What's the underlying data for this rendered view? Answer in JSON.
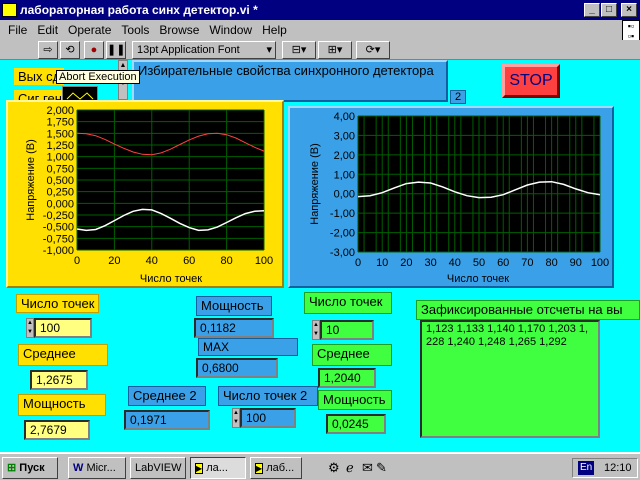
{
  "window": {
    "title": "лабораторная работа синх детектор.vi *"
  },
  "menu": [
    "File",
    "Edit",
    "Operate",
    "Tools",
    "Browse",
    "Window",
    "Help"
  ],
  "toolbar": {
    "font": "13pt Application Font",
    "tooltip": "Abort Execution"
  },
  "controls": {
    "out_label": "Вых сд",
    "gen_label": "Сиг ген",
    "desc": "Избирательные свойства  синхронного детектора",
    "desc_index": "2",
    "stop": "STOP"
  },
  "chart_data": [
    {
      "type": "line",
      "title": "",
      "xlabel": "Число точек",
      "ylabel": "Напряжение (В)",
      "xlim": [
        0,
        100
      ],
      "ylim": [
        -1,
        2
      ],
      "xticks": [
        "0",
        "20",
        "40",
        "60",
        "80",
        "100"
      ],
      "yticks": [
        "2,000",
        "1,750",
        "1,500",
        "1,250",
        "1,000",
        "0,750",
        "0,500",
        "0,250",
        "0,000",
        "-0,250",
        "-0,500",
        "-0,750",
        "-1,000"
      ],
      "grid": true,
      "colors": {
        "red": "#ff4040",
        "white": "#ffffff"
      },
      "series": [
        {
          "x": [
            0,
            5,
            10,
            15,
            20,
            25,
            30,
            35,
            40,
            45,
            50,
            55,
            60,
            65,
            70,
            75,
            80,
            85,
            90,
            95,
            100
          ],
          "values": [
            1.5,
            1.49,
            1.45,
            1.37,
            1.27,
            1.18,
            1.1,
            1.05,
            1.04,
            1.08,
            1.16,
            1.26,
            1.36,
            1.44,
            1.49,
            1.5,
            1.47,
            1.4,
            1.3,
            1.2,
            1.12
          ]
        },
        {
          "x": [
            0,
            5,
            10,
            15,
            20,
            25,
            30,
            35,
            40,
            45,
            50,
            55,
            60,
            65,
            70,
            75,
            80,
            85,
            90,
            95,
            100
          ],
          "values": [
            -0.55,
            -0.58,
            -0.56,
            -0.48,
            -0.37,
            -0.26,
            -0.17,
            -0.13,
            -0.14,
            -0.22,
            -0.32,
            -0.43,
            -0.52,
            -0.58,
            -0.57,
            -0.51,
            -0.41,
            -0.31,
            -0.22,
            -0.17,
            -0.16
          ]
        }
      ]
    },
    {
      "type": "line",
      "title": "",
      "xlabel": "Число точек",
      "ylabel": "Напряжение (В)",
      "xlim": [
        0,
        100
      ],
      "ylim": [
        -3,
        4
      ],
      "xticks": [
        "0",
        "10",
        "20",
        "30",
        "40",
        "50",
        "60",
        "70",
        "80",
        "90",
        "100"
      ],
      "yticks": [
        "4,00",
        "3,00",
        "2,00",
        "1,00",
        "0,00",
        "-1,00",
        "-2,00",
        "-3,00"
      ],
      "grid": true,
      "series": [
        {
          "x": [
            0,
            5,
            10,
            15,
            20,
            25,
            30,
            35,
            40,
            45,
            50,
            55,
            60,
            65,
            70,
            75,
            80,
            85,
            90,
            95,
            100
          ],
          "values": [
            -0.15,
            -0.1,
            0.05,
            0.3,
            0.52,
            0.6,
            0.55,
            0.35,
            0.1,
            -0.1,
            -0.2,
            -0.18,
            -0.05,
            0.2,
            0.45,
            0.6,
            0.62,
            0.48,
            0.25,
            0.05,
            -0.05
          ]
        }
      ]
    }
  ],
  "left": {
    "count_label": "Число точек",
    "count": "100",
    "mean_label": "Среднее",
    "mean": "1,2675",
    "power_label": "Мощность",
    "power": "2,7679"
  },
  "mid": {
    "power_label": "Мощность",
    "power": "0,1182",
    "max_label": "MAX",
    "max": "0,6800",
    "mean2_label": "Среднее 2",
    "mean2": "0,1971",
    "count2_label": "Число точек 2",
    "count2": "100"
  },
  "right": {
    "count_label": "Число точек",
    "count": "10",
    "mean_label": "Среднее",
    "mean": "1,2040",
    "power_label": "Мощность",
    "power": "0,0245"
  },
  "fixed": {
    "label": "Зафиксированные отсчеты  на вы",
    "text": "1,123 1,133 1,140 1,170 1,203 1,\n228 1,240 1,248 1,265 1,292"
  },
  "taskbar": {
    "start": "Пуск",
    "tasks": [
      "Micr...",
      "LabVIEW",
      "ла...",
      "лаб..."
    ],
    "lang": "En",
    "time": "12:10"
  }
}
